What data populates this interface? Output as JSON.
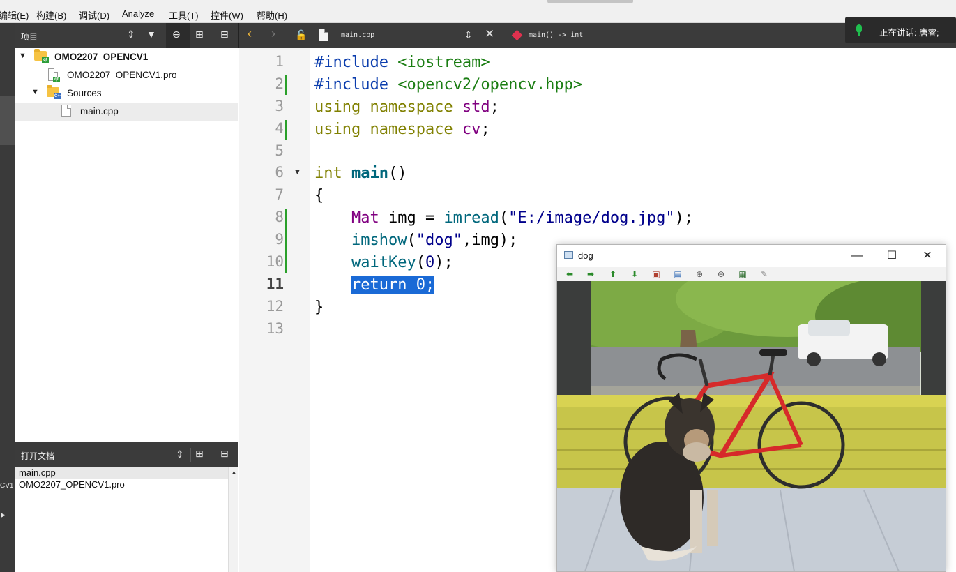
{
  "menubar": {
    "items": [
      "编辑(E)",
      "构建(B)",
      "调试(D)",
      "Analyze",
      "工具(T)",
      "控件(W)",
      "帮助(H)"
    ]
  },
  "modebar": {
    "clipped_label": "CV1"
  },
  "project_panel": {
    "title": "项目",
    "tree": {
      "project": "OMO2207_OPENCV1",
      "pro_file": "OMO2207_OPENCV1.pro",
      "sources_folder": "Sources",
      "source_file": "main.cpp"
    }
  },
  "open_documents": {
    "title": "打开文档",
    "items": [
      "main.cpp",
      "OMO2207_OPENCV1.pro"
    ]
  },
  "editor_toolbar": {
    "file_name": "main.cpp",
    "symbol": "main() -> int"
  },
  "speaking_notice": "正在讲话: 唐睿;",
  "editor": {
    "current_line": 11,
    "line_numbers": [
      "1",
      "2",
      "3",
      "4",
      "5",
      "6",
      "7",
      "8",
      "9",
      "10",
      "11",
      "12",
      "13"
    ],
    "lines": {
      "l1a": "#include",
      "l1b": " <iostream>",
      "l2a": "#include",
      "l2b": " <opencv2/opencv.hpp>",
      "l3a": "using namespace",
      "l3b": " std",
      "l3c": ";",
      "l4a": "using namespace",
      "l4b": " cv",
      "l4c": ";",
      "l6a": "int",
      "l6b": " main",
      "l6c": "()",
      "l7": "{",
      "l8a": "    Mat",
      "l8b": " img = ",
      "l8c": "imread",
      "l8d": "(",
      "l8e": "\"E:/image/dog.jpg\"",
      "l8f": ");",
      "l9a": "    ",
      "l9b": "imshow",
      "l9c": "(",
      "l9d": "\"dog\"",
      "l9e": ",img);",
      "l10a": "    ",
      "l10b": "waitKey",
      "l10c": "(",
      "l10d": "0",
      "l10e": ");",
      "l11a": "    ",
      "l11b": "return 0;",
      "l12": "}"
    }
  },
  "image_window": {
    "title": "dog",
    "buttons": {
      "minimize": "—",
      "maximize": "☐",
      "close": "✕"
    },
    "toolbar_icons": [
      "arrow-left-icon",
      "arrow-right-icon",
      "arrow-up-icon",
      "arrow-down-icon",
      "image-icon",
      "save-image-icon",
      "zoom-in-icon",
      "zoom-out-icon",
      "save-icon",
      "properties-icon"
    ]
  },
  "colors": {
    "dark_panel": "#3b3b3b",
    "selection": "#1a6ad6",
    "change_marker": "#2aa02a"
  }
}
